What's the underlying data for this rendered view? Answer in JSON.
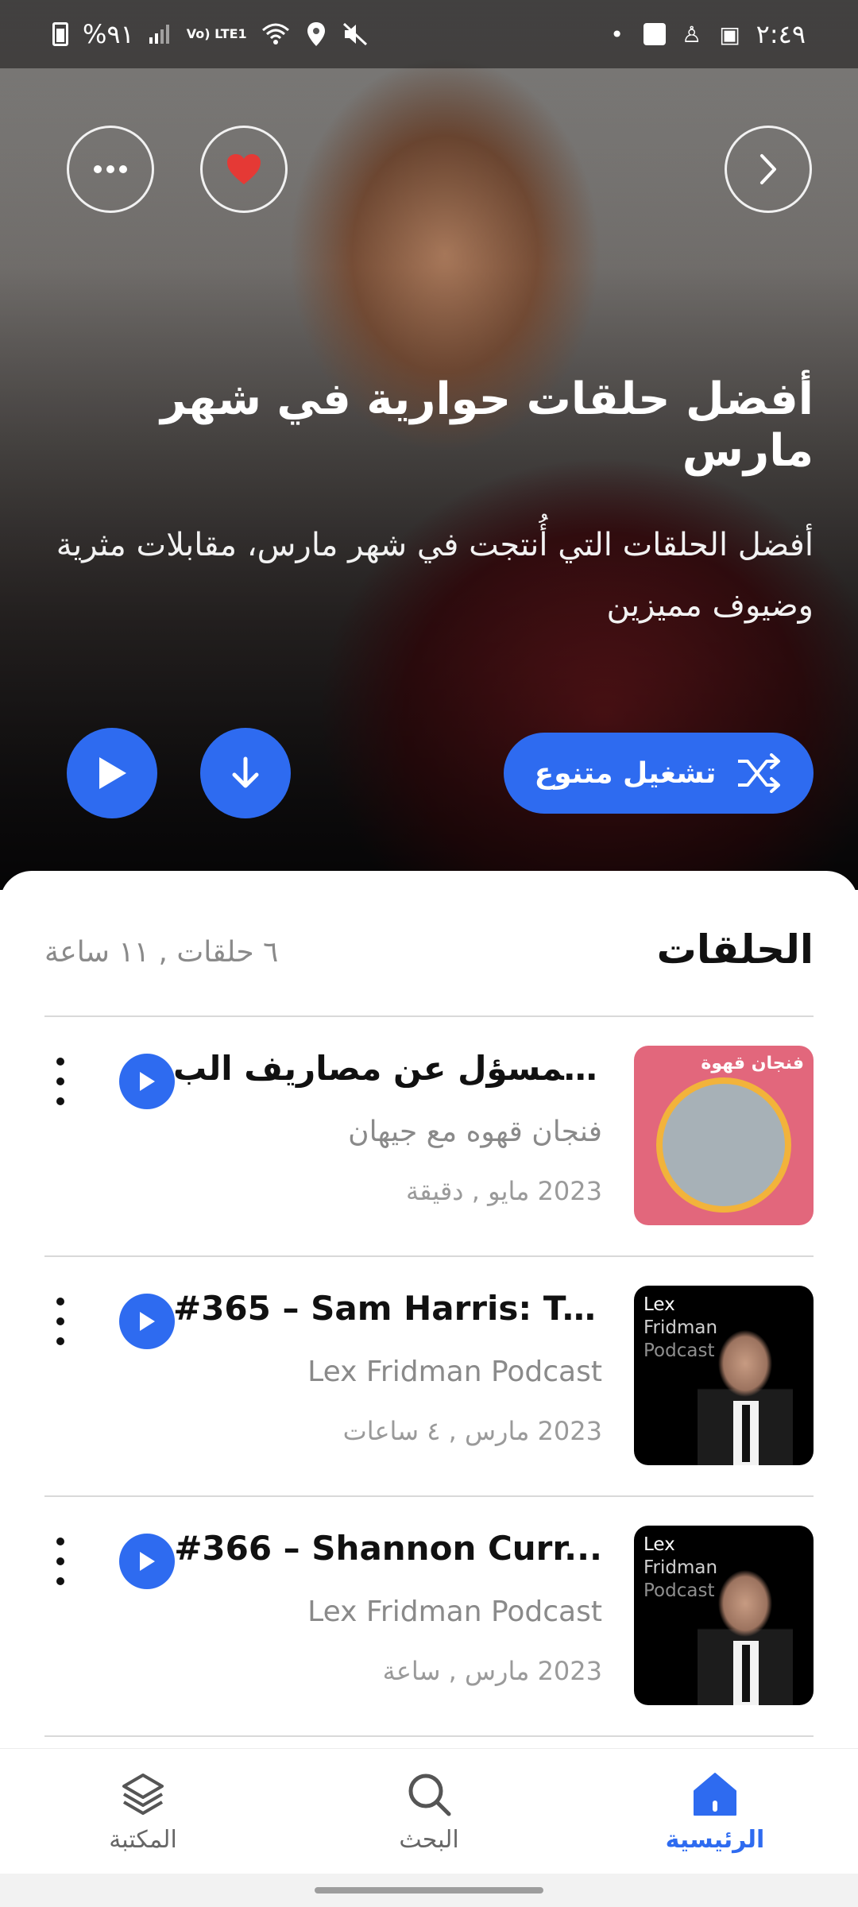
{
  "status_bar": {
    "time": "٢:٤٩",
    "battery": "%٩١",
    "network": "Vo) LTE1"
  },
  "hero": {
    "title": "أفضل حلقات حوارية في شهر مارس",
    "description": "أفضل الحلقات التي أُنتجت في شهر مارس، مقابلات مثرية وضيوف مميزين",
    "shuffle_label": "تشغيل متنوع"
  },
  "episodes_section": {
    "title": "الحلقات",
    "meta": "٦ حلقات , ١١ ساعة"
  },
  "episodes": [
    {
      "title": "مين المسؤل عن مصاريف الب...",
      "podcast": "فنجان قهوه مع جيهان",
      "date": "2023 مايو , دقيقة",
      "thumb_text": "فنجان قهوة"
    },
    {
      "title": "#365 – Sam Harris: Tr...",
      "podcast": "Lex Fridman Podcast",
      "date": "2023 مارس , ٤ ساعات",
      "thumb_lines": [
        "Lex",
        "Fridman",
        "Podcast"
      ]
    },
    {
      "title": "#366 – Shannon Curr...",
      "podcast": "Lex Fridman Podcast",
      "date": "2023 مارس , ساعة",
      "thumb_lines": [
        "Lex",
        "Fridman",
        "Podcast"
      ]
    }
  ],
  "nav": {
    "library": "المكتبة",
    "search": "البحث",
    "home": "الرئيسية"
  },
  "colors": {
    "accent": "#2e6bf0",
    "heart": "#e53935"
  }
}
